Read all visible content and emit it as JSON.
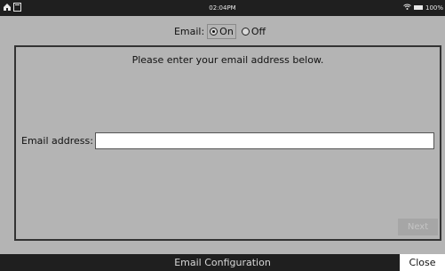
{
  "status_bar": {
    "time": "02:04PM",
    "battery": "100%",
    "icons": [
      "home-icon",
      "document-icon",
      "wifi-icon",
      "battery-icon"
    ]
  },
  "email_toggle": {
    "label": "Email:",
    "options": [
      {
        "label": "On",
        "selected": true
      },
      {
        "label": "Off",
        "selected": false
      }
    ]
  },
  "panel": {
    "instruction": "Please enter your email address below.",
    "email_label": "Email address:",
    "email_value": "",
    "next_label": "Next"
  },
  "footer": {
    "title": "Email Configuration",
    "close_label": "Close"
  }
}
